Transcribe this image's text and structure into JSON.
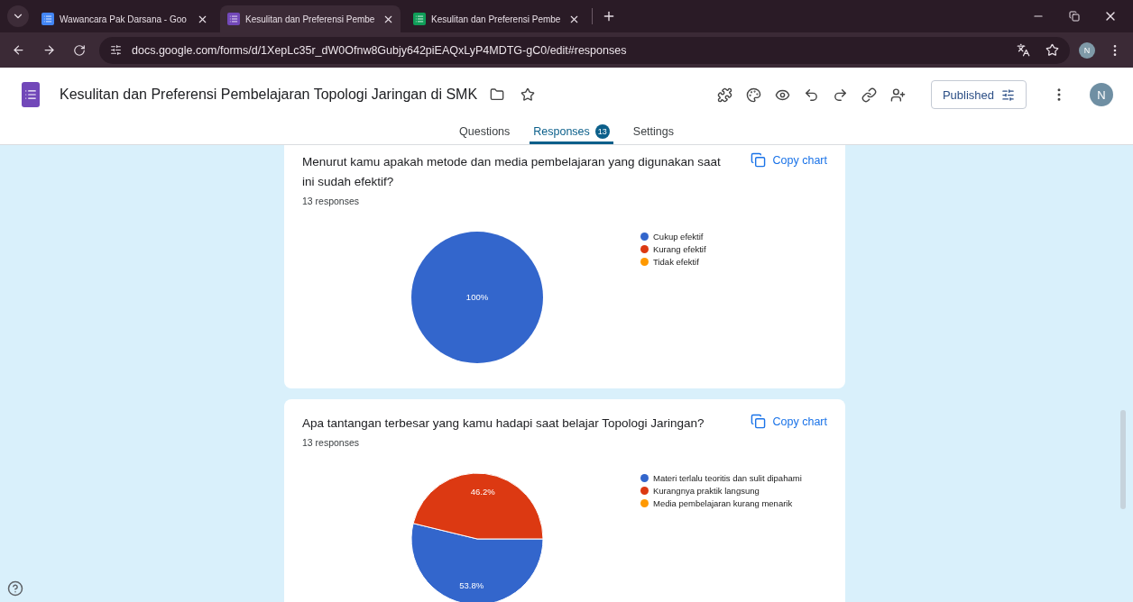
{
  "browser": {
    "tabs": [
      {
        "title": "Wawancara Pak Darsana - Goo",
        "kind": "docs",
        "selected": false
      },
      {
        "title": "Kesulitan dan Preferensi Pembe",
        "kind": "forms",
        "selected": true
      },
      {
        "title": "Kesulitan dan Preferensi Pembe",
        "kind": "sheets",
        "selected": false
      }
    ],
    "url": "docs.google.com/forms/d/1XepLc35r_dW0Ofnw8Gubjy642piEAQxLyP4MDTG-gC0/edit#responses",
    "profile_initial": "N"
  },
  "form": {
    "title": "Kesulitan dan Preferensi Pembelajaran Topologi Jaringan di SMK",
    "publish_button": "Published",
    "avatar_initial": "N",
    "tabs": [
      {
        "label": "Questions",
        "selected": false
      },
      {
        "label": "Responses",
        "badge": "13",
        "selected": true
      },
      {
        "label": "Settings",
        "selected": false
      }
    ]
  },
  "questions": [
    {
      "title": "Menurut kamu apakah metode dan media pembelajaran yang digunakan saat ini sudah efektif?",
      "responses": "13 responses",
      "copy_button": "Copy chart",
      "chart_data": {
        "type": "pie",
        "categories": [
          "Cukup efektif",
          "Kurang efektif",
          "Tidak efektif"
        ],
        "values": [
          100,
          0,
          0
        ],
        "legend": "right",
        "colors": [
          "#3366cc",
          "#dc3912",
          "#ff9900"
        ],
        "value_labels": [
          "100%",
          null,
          null
        ]
      }
    },
    {
      "title": "Apa tantangan terbesar yang kamu hadapi saat belajar Topologi Jaringan?",
      "responses": "13 responses",
      "copy_button": "Copy chart",
      "chart_data": {
        "type": "pie",
        "categories": [
          "Materi terlalu teoritis dan sulit dipahami",
          "Kurangnya praktik langsung",
          "Media pembelajaran kurang menarik"
        ],
        "values": [
          53.8,
          46.2,
          0
        ],
        "legend": "right",
        "colors": [
          "#3366cc",
          "#dc3912",
          "#ff9900"
        ],
        "value_labels": [
          "53.8%",
          "46.2%",
          null
        ]
      }
    }
  ]
}
